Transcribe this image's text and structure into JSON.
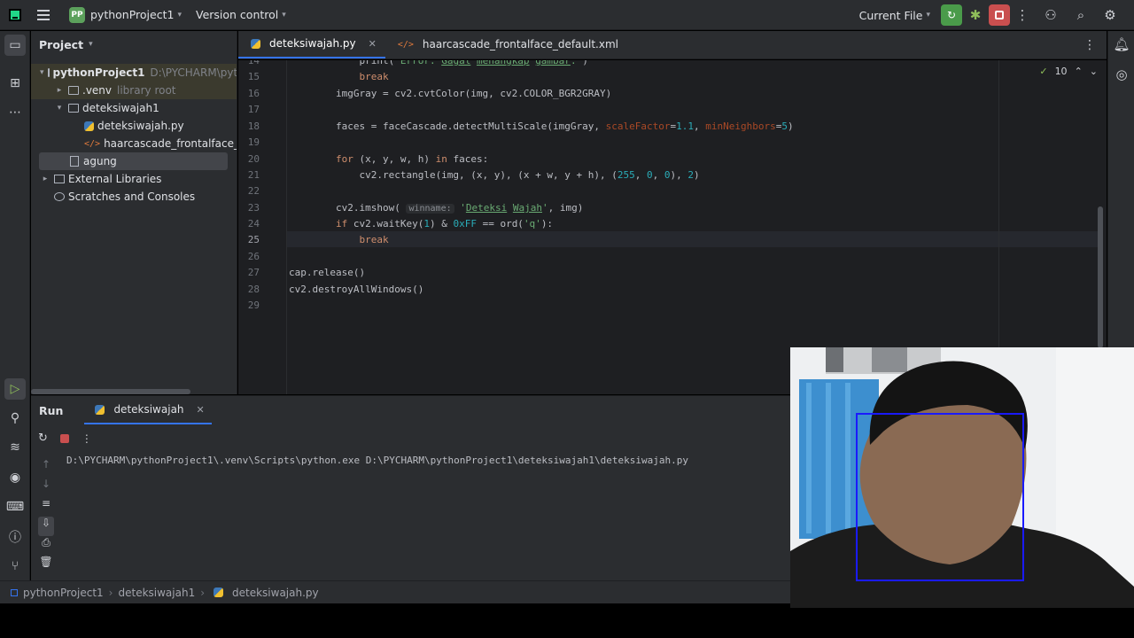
{
  "titlebar": {
    "project_badge": "PP",
    "project_name": "pythonProject1",
    "vcs": "Version control",
    "run_config": "Current File"
  },
  "project_panel": {
    "title": "Project",
    "tree": [
      {
        "label": "pythonProject1",
        "hint": "D:\\PYCHARM\\pytho"
      },
      {
        "label": ".venv",
        "hint": "library root"
      },
      {
        "label": "deteksiwajah1",
        "hint": ""
      },
      {
        "label": "deteksiwajah.py",
        "hint": ""
      },
      {
        "label": "haarcascade_frontalface_defau",
        "hint": ""
      },
      {
        "label": "agung",
        "hint": ""
      },
      {
        "label": "External Libraries",
        "hint": ""
      },
      {
        "label": "Scratches and Consoles",
        "hint": ""
      }
    ]
  },
  "editor": {
    "tabs": [
      "deteksiwajah.py",
      "haarcascade_frontalface_default.xml"
    ],
    "inspection_count": "10",
    "line_numbers": [
      "14",
      "15",
      "16",
      "17",
      "18",
      "19",
      "20",
      "21",
      "22",
      "23",
      "24",
      "25",
      "26",
      "27",
      "28",
      "29"
    ],
    "current_line": "25"
  },
  "run_panel": {
    "title": "Run",
    "tab": "deteksiwajah",
    "console_line": "D:\\PYCHARM\\pythonProject1\\.venv\\Scripts\\python.exe D:\\PYCHARM\\pythonProject1\\deteksiwajah1\\deteksiwajah.py"
  },
  "statusbar": {
    "crumbs": [
      "pythonProject1",
      "deteksiwajah1",
      "deteksiwajah.py"
    ]
  },
  "webcam": {
    "detection_color": "#1a1aff"
  }
}
